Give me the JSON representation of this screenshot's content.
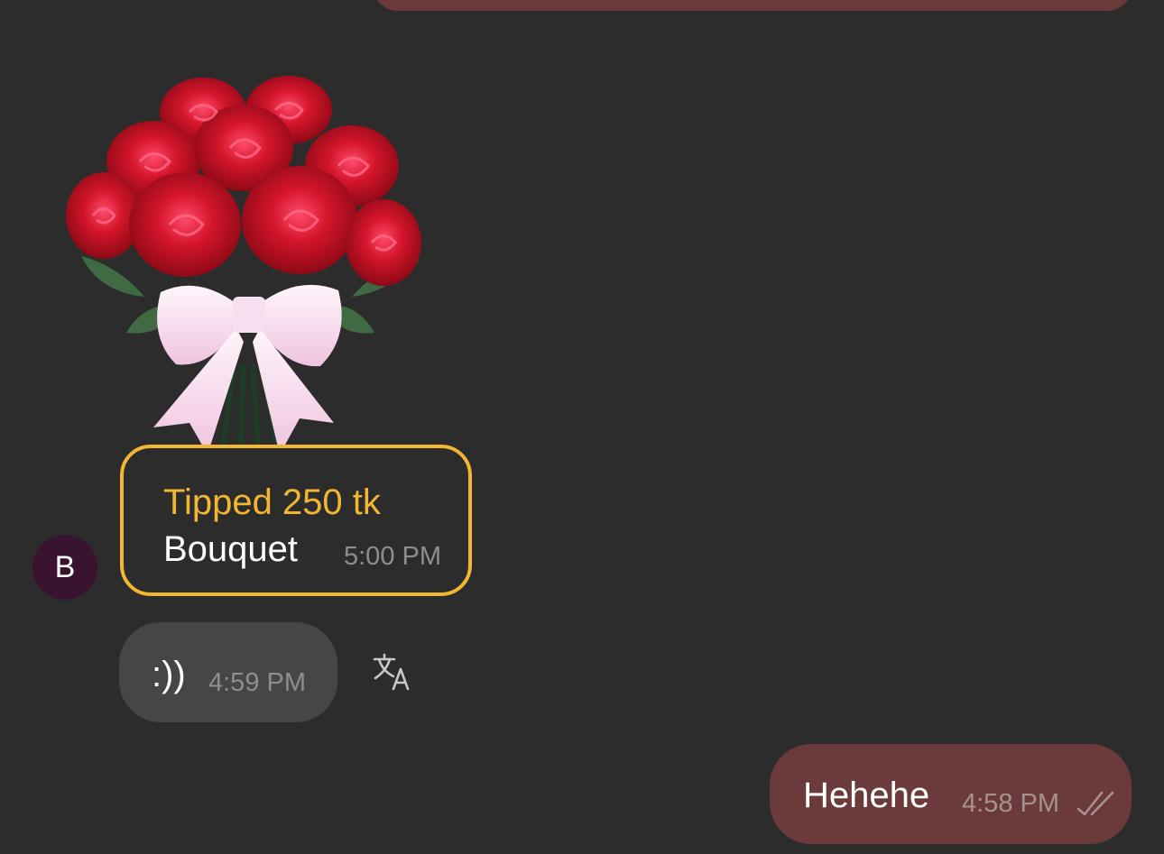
{
  "tip_card": {
    "title": "Tipped 250 tk",
    "gift_name": "Bouquet",
    "time": "5:00 PM",
    "sticker_icon": "rose-bouquet-sticker",
    "accent_color": "#f2b632"
  },
  "avatar": {
    "initial": "B",
    "color": "#3a1330"
  },
  "messages": [
    {
      "direction": "incoming",
      "text": ":))",
      "time": "4:59 PM",
      "action_icon": "translate-icon"
    },
    {
      "direction": "outgoing",
      "text": "Hehehe",
      "time": "4:58 PM",
      "status_icon": "double-check-icon"
    }
  ],
  "colors": {
    "background": "#2c2c2c",
    "incoming_bubble": "#464646",
    "outgoing_bubble": "#6b3a3a"
  }
}
